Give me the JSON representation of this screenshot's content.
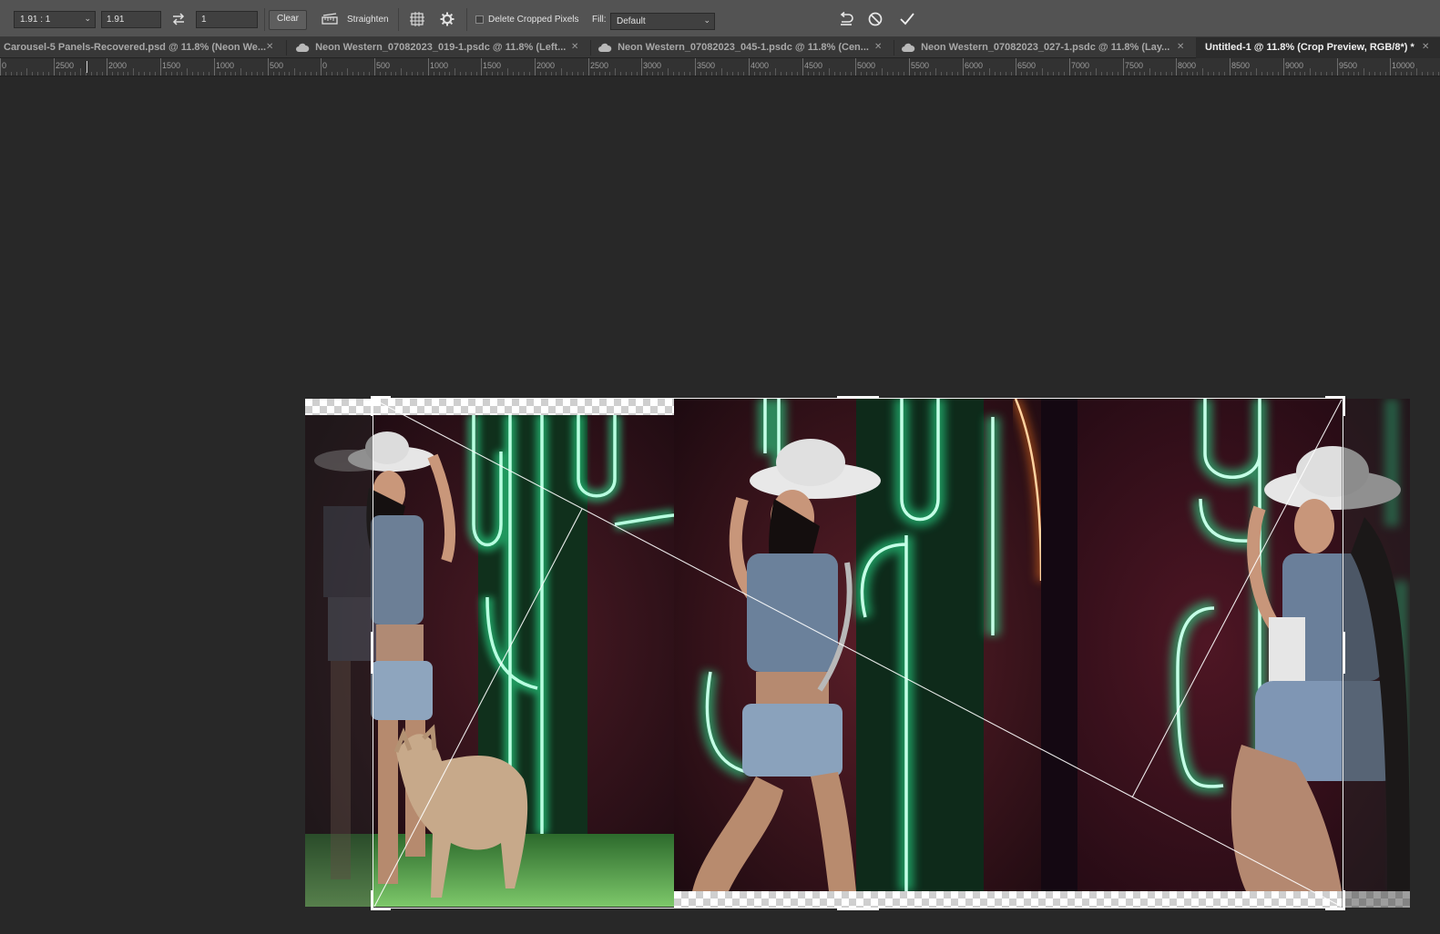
{
  "options_bar": {
    "ratio_preset": "1.91 : 1",
    "width_value": "1.91",
    "height_value": "1",
    "clear_label": "Clear",
    "straighten_label": "Straighten",
    "delete_cropped_label": "Delete Cropped Pixels",
    "delete_cropped_checked": false,
    "fill_label": "Fill:",
    "fill_value": "Default"
  },
  "tabs": [
    {
      "label": "Carousel-5 Panels-Recovered.psd @ 11.8% (Neon We...",
      "cloud": false,
      "active": false
    },
    {
      "label": "Neon Western_07082023_019-1.psdc @ 11.8% (Left...",
      "cloud": true,
      "active": false
    },
    {
      "label": "Neon Western_07082023_045-1.psdc @ 11.8% (Cen...",
      "cloud": true,
      "active": false
    },
    {
      "label": "Neon Western_07082023_027-1.psdc @ 11.8% (Lay...",
      "cloud": true,
      "active": false
    },
    {
      "label": "Untitled-1 @ 11.8% (Crop Preview, RGB/8*) *",
      "cloud": false,
      "active": true
    }
  ],
  "ruler": {
    "labels": [
      "0",
      "2500",
      "2000",
      "1500",
      "1000",
      "500",
      "0",
      "500",
      "1000",
      "1500",
      "2000",
      "2500",
      "3000",
      "3500",
      "4000",
      "4500",
      "5000",
      "5500",
      "6000",
      "6500",
      "7000",
      "7500",
      "8000",
      "8500",
      "9000",
      "9500",
      "10000"
    ]
  },
  "colors": {
    "neon_green": "#2dffa0",
    "neon_orange": "#ff7a1a",
    "crop_frame": "#f2f2f2",
    "panel_bg": "#535353"
  },
  "icons": [
    "swap-icon",
    "straighten-icon",
    "overlay-grid-icon",
    "gear-icon",
    "reset-icon",
    "cancel-icon",
    "commit-check-icon",
    "close-icon",
    "cloud-icon",
    "chevron-down-icon"
  ]
}
